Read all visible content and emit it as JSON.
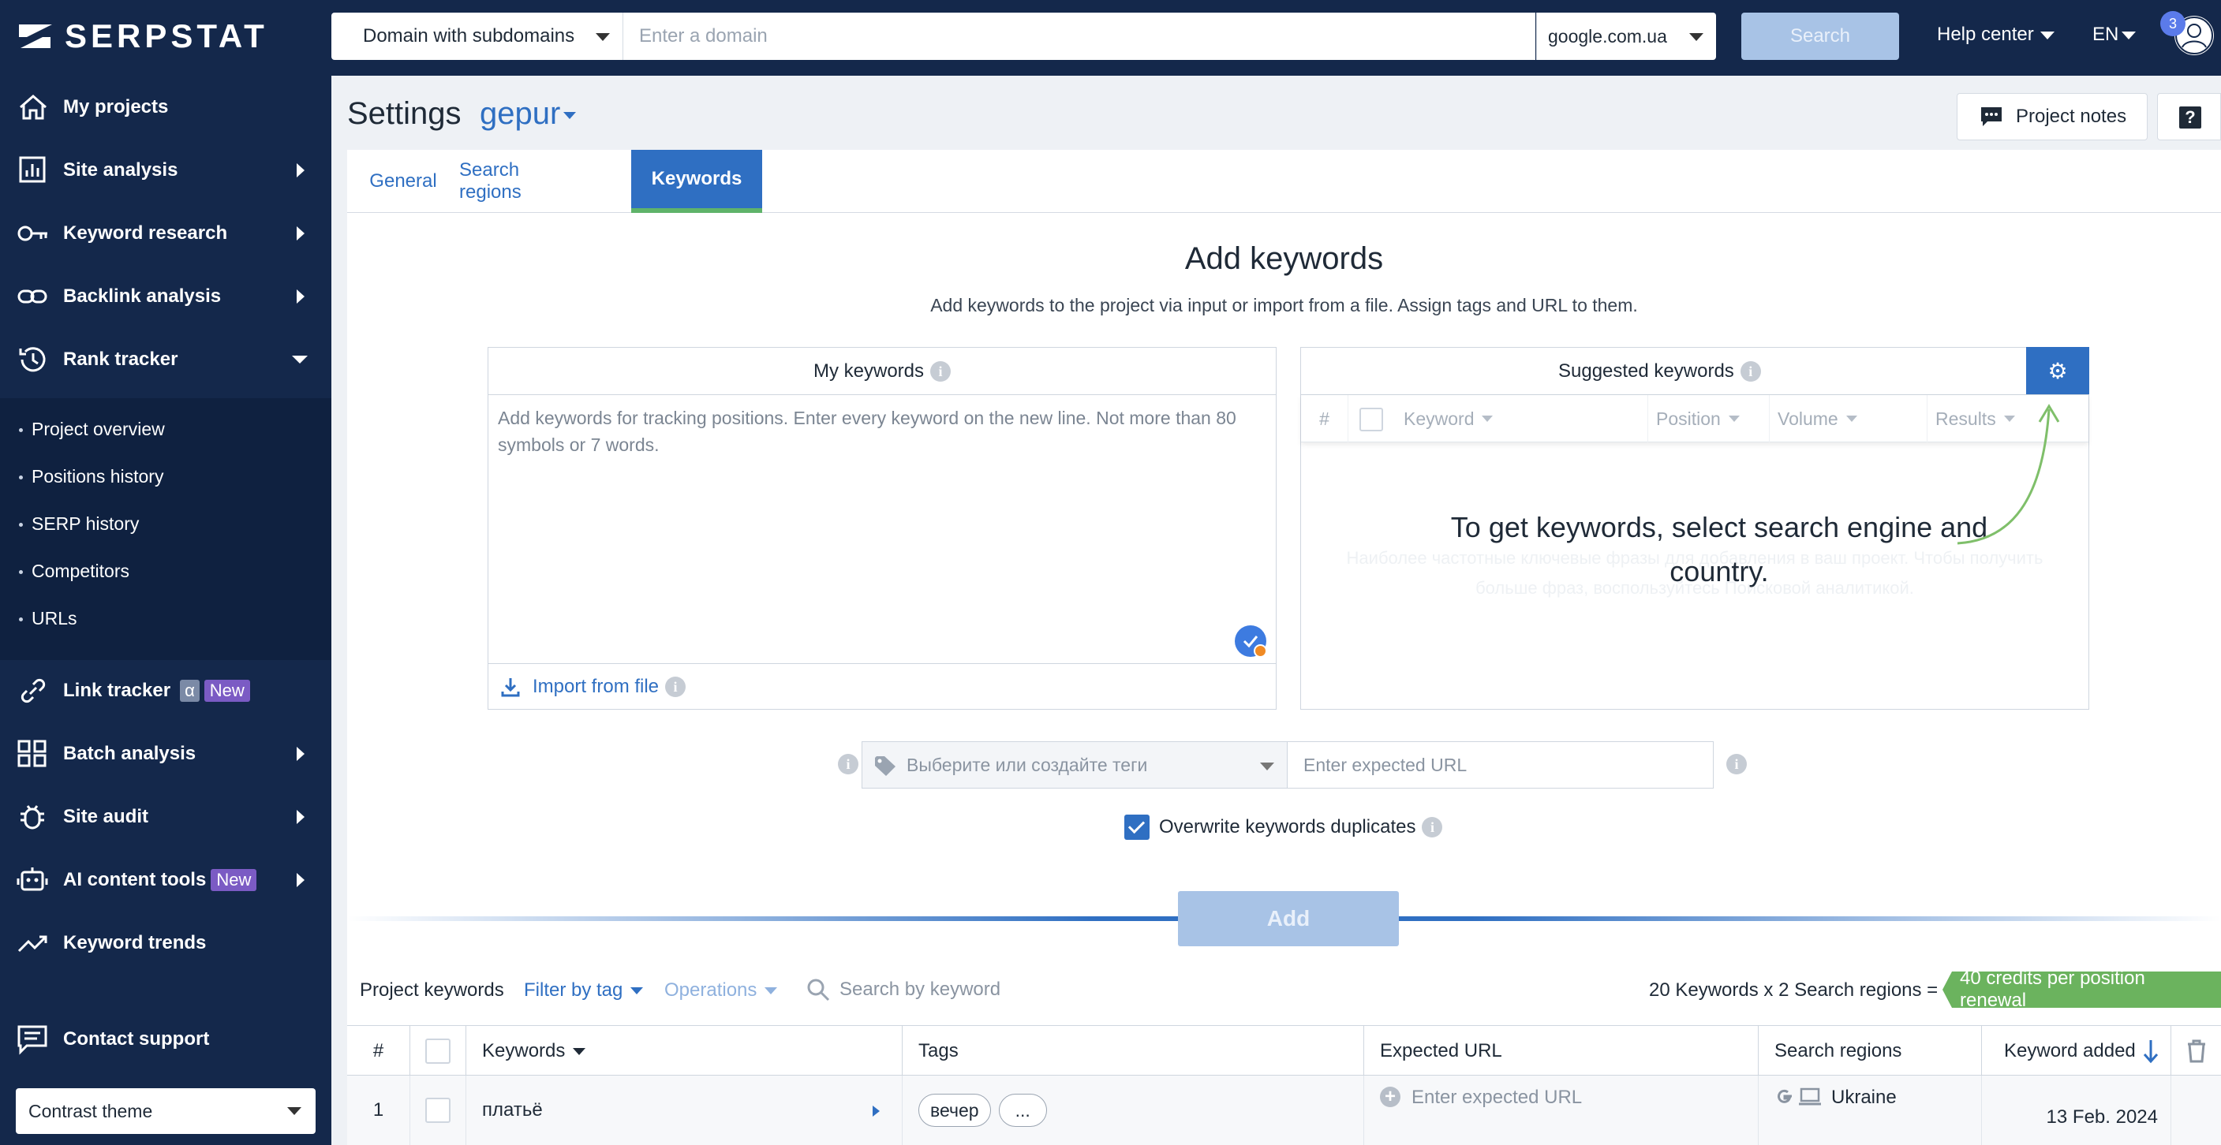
{
  "brand": {
    "logo_text": "SERPSTAT"
  },
  "sidebar": {
    "items": [
      {
        "label": "My projects",
        "icon": "home-icon"
      },
      {
        "label": "Site analysis",
        "icon": "bar-chart-icon"
      },
      {
        "label": "Keyword research",
        "icon": "key-icon"
      },
      {
        "label": "Backlink analysis",
        "icon": "link-icon"
      },
      {
        "label": "Rank tracker",
        "icon": "history-icon"
      },
      {
        "label": "Link tracker",
        "icon": "chain-icon",
        "badge_alpha": "α",
        "badge_new": "New"
      },
      {
        "label": "Batch analysis",
        "icon": "grid-icon"
      },
      {
        "label": "Site audit",
        "icon": "bug-icon"
      },
      {
        "label": "AI content tools",
        "icon": "robot-icon",
        "badge_new": "New"
      },
      {
        "label": "Keyword trends",
        "icon": "trend-icon"
      },
      {
        "label": "Contact support",
        "icon": "chat-icon"
      }
    ],
    "rank_tracker_sub": [
      "Project overview",
      "Positions history",
      "SERP history",
      "Competitors",
      "URLs"
    ],
    "theme_select": "Contrast theme"
  },
  "topbar": {
    "scope": "Domain with subdomains",
    "domain_placeholder": "Enter a domain",
    "engine": "google.com.ua",
    "search_label": "Search",
    "help_center": "Help center",
    "lang": "EN",
    "notifications": "3"
  },
  "header": {
    "title": "Settings",
    "project": "gepur",
    "notes_label": "Project notes",
    "help_label": "?"
  },
  "tabs": [
    {
      "label": "General",
      "active": false
    },
    {
      "label": "Search regions",
      "active": false
    },
    {
      "label": "Keywords",
      "active": true
    }
  ],
  "add": {
    "title": "Add keywords",
    "subtitle": "Add keywords to the project via input or import from a file. Assign tags and URL to them.",
    "my_keywords": "My keywords",
    "kw_placeholder": "Add keywords for tracking positions. Enter every keyword on the new line. Not more than 80 symbols or 7 words.",
    "import_label": "Import from file",
    "suggested_keywords": "Suggested keywords",
    "suggest_cols": [
      "#",
      "Keyword",
      "Position",
      "Volume",
      "Results"
    ],
    "suggest_empty": "To get keywords, select search engine and country.",
    "suggest_ghost_1": "Наиболее частотные ключевые фразы для добавления в ваш проект. Чтобы получить",
    "suggest_ghost_2": "больше фраз, воспользуйтесь Поисковой аналитикой.",
    "tag_placeholder": "Выберите или создайте теги",
    "url_placeholder": "Enter expected URL",
    "overwrite_label": "Overwrite keywords duplicates",
    "add_button": "Add"
  },
  "project_keywords": {
    "title": "Project keywords",
    "filter": "Filter by tag",
    "operations": "Operations",
    "search_placeholder": "Search by keyword",
    "count_text": "20 Keywords x 2 Search regions =",
    "credits": "40 credits per position renewal"
  },
  "table": {
    "headers": [
      "#",
      "",
      "Keywords",
      "Tags",
      "Expected URL",
      "Search regions",
      "Keyword added"
    ],
    "rows": [
      {
        "num": "1",
        "keyword": "платьё",
        "tags": [
          "вечер",
          "..."
        ],
        "url": "Enter expected URL",
        "region": "Ukraine",
        "added": "13 Feb. 2024"
      }
    ]
  },
  "colors": {
    "sidebar": "#14284b",
    "accent": "#2f6fc2",
    "credits": "#6bb35e",
    "new_badge": "#7b5bc4"
  }
}
